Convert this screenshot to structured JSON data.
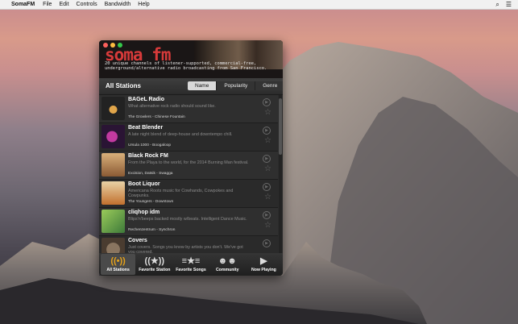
{
  "menubar": {
    "app_name": "SomaFM",
    "items": [
      "File",
      "Edit",
      "Controls",
      "Bandwidth",
      "Help"
    ],
    "right_icons": [
      "search-icon",
      "list-icon"
    ]
  },
  "header": {
    "logo": "soma fm",
    "tagline": "20 unique channels of listener-supported, commercial-free, underground/alternative radio broadcasting from San Francisco."
  },
  "subbar": {
    "title": "All Stations",
    "sort_options": [
      "Name",
      "Popularity",
      "Genre"
    ],
    "selected": "Name"
  },
  "stations": [
    {
      "name": "BAGeL Radio",
      "desc": "What alternative rock radio should sound like.",
      "now": "The Growlers - Chinese Fountain",
      "color": "#222222"
    },
    {
      "name": "Beat Blender",
      "desc": "A late night blend of deep-house and downtempo chill.",
      "now": "Ursula 1000 - Boogaloop",
      "color": "#3a1d4a"
    },
    {
      "name": "Black Rock FM",
      "desc": "From the Playa to the world, for the 2014 Burning Man festival.",
      "now": "Excision, Datsik - Swagga",
      "color": "#b98a5a"
    },
    {
      "name": "Boot Liquor",
      "desc": "Americana Roots music for Cowhands, Cowpokes and Cowpunks.",
      "now": "The Youngers - Downtown",
      "color": "#c2702e"
    },
    {
      "name": "cliqhop idm",
      "desc": "Blips'n'beeps backed mostly w/beats. Intelligent Dance Music.",
      "now": "Rechenzentrum - Synchron",
      "color": "#5f9a3e"
    },
    {
      "name": "Covers",
      "desc": "Just covers. Songs you know by artists you don't. We've got you covered.",
      "now": "",
      "color": "#6a5a48"
    }
  ],
  "tabs": [
    {
      "label": "All Stations",
      "icon": "broadcast-icon"
    },
    {
      "label": "Favorite Station",
      "icon": "favorite-broadcast-icon"
    },
    {
      "label": "Favorite Songs",
      "icon": "star-list-icon"
    },
    {
      "label": "Community",
      "icon": "community-icon"
    },
    {
      "label": "Now Playing",
      "icon": "play-icon"
    }
  ],
  "colors": {
    "logo_red": "#d73a3a",
    "active_tab_icon": "#e6a21b"
  }
}
